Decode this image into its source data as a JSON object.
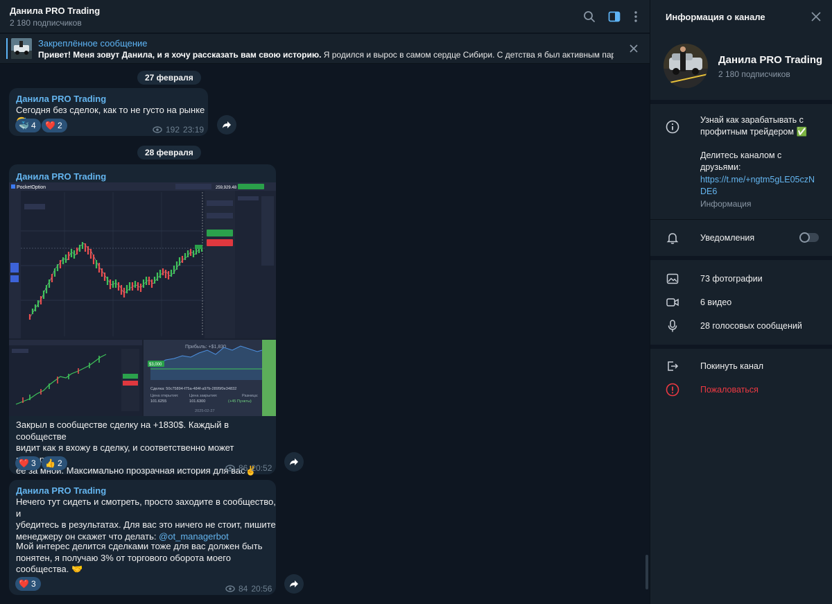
{
  "chat": {
    "title": "Данила PRO Trading",
    "subscribers": "2 180 подписчиков"
  },
  "pinned": {
    "title": "Закреплённое сообщение",
    "bold": "Привет! Меня зовут Данила, и я хочу рассказать вам свою историю.",
    "rest": "  Я родился и вырос в самом сердце Сибири. С детства я был активным пар..."
  },
  "dates": [
    "27 февраля",
    "28 февраля"
  ],
  "messages": [
    {
      "author": "Данила PRO Trading",
      "text": "Сегодня без сделок, как то не густо на рынке😅",
      "reactions": [
        {
          "emoji": "🐳",
          "count": "4"
        },
        {
          "emoji": "❤️",
          "count": "2"
        }
      ],
      "views": "192",
      "time": "23:19"
    },
    {
      "author": "Данила PRO Trading",
      "text": "Закрыл в сообществе сделку на +1830$. Каждый в сообществе\nвидит как я вхожу в сделку, и соответственно может повторить\nеё за мной. Максимально прозрачная история для вас✌️",
      "reactions": [
        {
          "emoji": "❤️",
          "count": "3"
        },
        {
          "emoji": "👍",
          "count": "2"
        }
      ],
      "views": "86",
      "time": "20:52",
      "screenshot": {
        "brand": "PocketOption",
        "balance": "259,929.48",
        "profit": "Прибыль: +$1,830",
        "deal": "Сделка: 50c75894-f75a-484f-a97b-2895f0e34832",
        "open_label": "Цена открытия:",
        "open_value": "101.6255",
        "close_label": "Цена закрытия:",
        "close_value": "101.6300",
        "diff_label": "Разница:",
        "diff_value": "(+45 Пункты)",
        "date": "2025-02-27",
        "marker": "$3,000"
      }
    },
    {
      "author": "Данила PRO Trading",
      "text_a": "Нечего тут сидеть и смотреть, просто заходите в сообщество, и\nубедитесь в результатах. Для вас это ничего не стоит, пишите\nменеджеру он скажет что делать: ",
      "mention": "@ot_managerbot",
      "text_b": "Мой интерес делится сделками тоже для вас должен быть\nпонятен, я получаю 3% от торгового оборота моего\nсообщества. 🤝",
      "reactions": [
        {
          "emoji": "❤️",
          "count": "3"
        }
      ],
      "views": "84",
      "time": "20:56"
    }
  ],
  "side": {
    "header": "Информация о канале",
    "name": "Данила PRO Trading",
    "subscribers": "2 180 подписчиков",
    "about": "Узнай как зарабатывать с\nпрофитным трейдером ✅\n\nДелитесь каналом с\nдрузьями:",
    "link": "https://t.me/+ngtm5gLE05czN\nDE6",
    "info_label": "Информация",
    "notifications": "Уведомления",
    "media": [
      {
        "icon": "photo-icon",
        "label": "73 фотографии"
      },
      {
        "icon": "video-icon",
        "label": "6 видео"
      },
      {
        "icon": "microphone-icon",
        "label": "28 голосовых сообщений"
      }
    ],
    "leave": "Покинуть канал",
    "report": "Пожаловаться"
  },
  "colors": {
    "accent": "#64b5ef",
    "danger": "#ec3942",
    "bubble": "#182533",
    "background": "#0e1621",
    "panel": "#17212b"
  }
}
